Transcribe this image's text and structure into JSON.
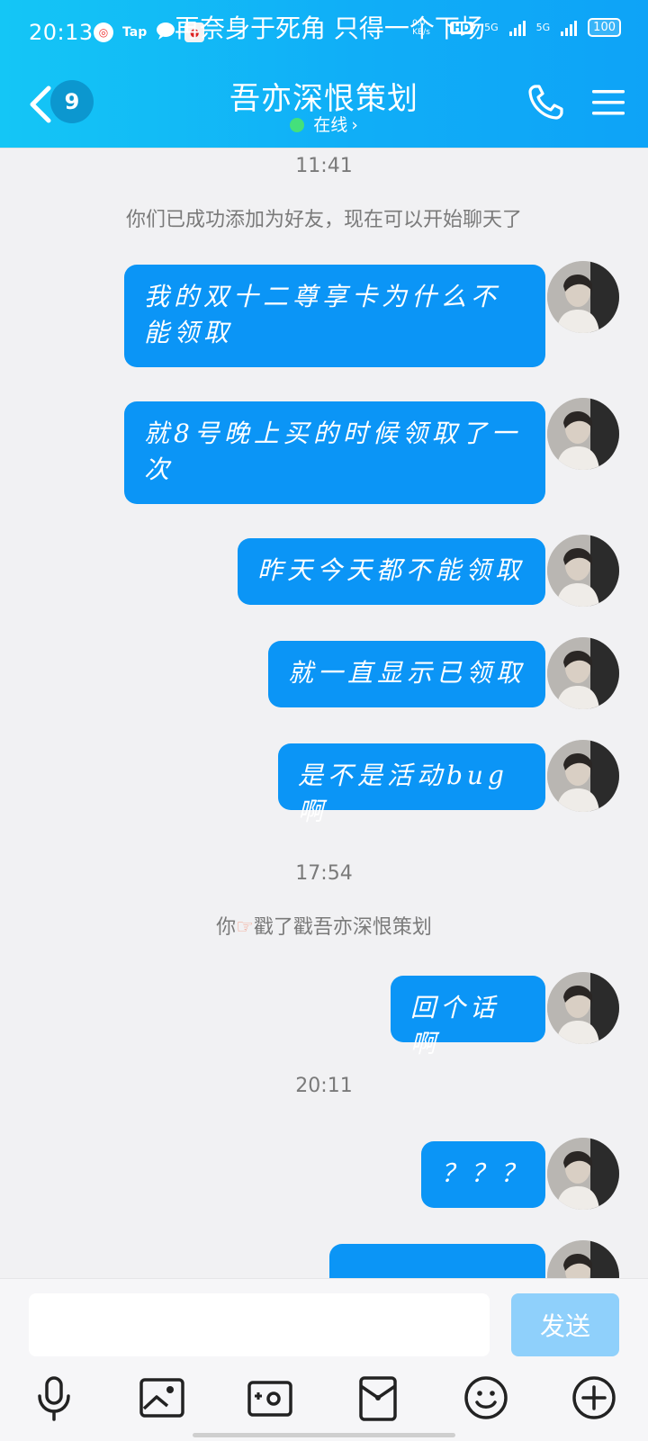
{
  "status_bar": {
    "time": "20:13",
    "app_icons": [
      "netease-music-icon",
      "taptap-icon",
      "chat-bubble-icon",
      "game-app-icon"
    ],
    "tap_label": "Tap",
    "now_playing": "再奈身于死角 只得一个下场",
    "net_speed": "0.0 KB/s",
    "network_1": "5G",
    "network_2": "5G",
    "hd_label": "HD",
    "battery": "100"
  },
  "header": {
    "back_badge": "9",
    "title": "吾亦深恨策划",
    "status": "在线"
  },
  "chat": {
    "time_1": "11:41",
    "system_note_1": "你们已成功添加为好友，现在可以开始聊天了",
    "messages_1": [
      {
        "text": "我的双十二尊享卡为什么不能领取"
      },
      {
        "text": "就8号晚上买的时候领取了一次"
      },
      {
        "text": "昨天今天都不能领取"
      },
      {
        "text": "就一直显示已领取"
      },
      {
        "text": "是不是活动bug啊"
      }
    ],
    "time_2": "17:54",
    "poke_prefix": "你",
    "poke_suffix": "戳了戳吾亦深恨策划",
    "messages_2": [
      {
        "text": "回个话啊"
      }
    ],
    "time_3": "20:11",
    "messages_3": [
      {
        "text": "？？？"
      }
    ]
  },
  "composer": {
    "input_value": "",
    "send_label": "发送",
    "tools": [
      "microphone-icon",
      "image-icon",
      "camera-icon",
      "red-packet-icon",
      "emoji-icon",
      "plus-icon"
    ]
  },
  "colors": {
    "header_gradient_start": "#14c6f6",
    "header_gradient_end": "#0ea3f7",
    "bubble": "#0b95f6",
    "send_button": "#8fd0fb",
    "online_dot": "#44e07b"
  }
}
